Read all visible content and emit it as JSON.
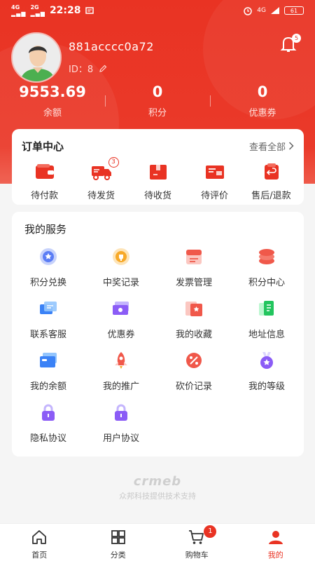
{
  "status_bar": {
    "signal_1": "4G",
    "signal_2": "2G",
    "time": "22:28",
    "network": "4G",
    "battery": "61"
  },
  "profile": {
    "username": "881acccc0a72",
    "id_text": "ID：8",
    "notification_count": "5"
  },
  "stats": [
    {
      "value": "9553.69",
      "label": "余额"
    },
    {
      "value": "0",
      "label": "积分"
    },
    {
      "value": "0",
      "label": "优惠券"
    }
  ],
  "orders": {
    "title": "订单中心",
    "view_all": "查看全部",
    "items": [
      {
        "label": "待付款",
        "icon": "wallet-icon"
      },
      {
        "label": "待发货",
        "icon": "delivery-truck-icon",
        "badge": "3"
      },
      {
        "label": "待收货",
        "icon": "package-icon"
      },
      {
        "label": "待评价",
        "icon": "review-icon"
      },
      {
        "label": "售后/退款",
        "icon": "refund-icon"
      }
    ]
  },
  "services": {
    "title": "我的服务",
    "items": [
      {
        "label": "积分兑换",
        "icon": "points-exchange-icon"
      },
      {
        "label": "中奖记录",
        "icon": "prize-record-icon"
      },
      {
        "label": "发票管理",
        "icon": "invoice-icon"
      },
      {
        "label": "积分中心",
        "icon": "points-center-icon"
      },
      {
        "label": "联系客服",
        "icon": "customer-service-icon"
      },
      {
        "label": "优惠券",
        "icon": "coupon-icon"
      },
      {
        "label": "我的收藏",
        "icon": "favorites-icon"
      },
      {
        "label": "地址信息",
        "icon": "address-icon"
      },
      {
        "label": "我的余额",
        "icon": "balance-card-icon"
      },
      {
        "label": "我的推广",
        "icon": "promotion-rocket-icon"
      },
      {
        "label": "砍价记录",
        "icon": "bargain-icon"
      },
      {
        "label": "我的等级",
        "icon": "level-medal-icon"
      },
      {
        "label": "隐私协议",
        "icon": "privacy-lock-icon"
      },
      {
        "label": "用户协议",
        "icon": "user-agreement-lock-icon"
      }
    ]
  },
  "footer": {
    "brand": "crmeb",
    "support_text": "众邦科技提供技术支持"
  },
  "tabbar": {
    "items": [
      {
        "label": "首页",
        "icon": "home-icon"
      },
      {
        "label": "分类",
        "icon": "category-grid-icon"
      },
      {
        "label": "购物车",
        "icon": "cart-icon",
        "badge": "1"
      },
      {
        "label": "我的",
        "icon": "user-icon"
      }
    ]
  },
  "colors": {
    "primary": "#e93323",
    "background": "#f5f5f5"
  }
}
